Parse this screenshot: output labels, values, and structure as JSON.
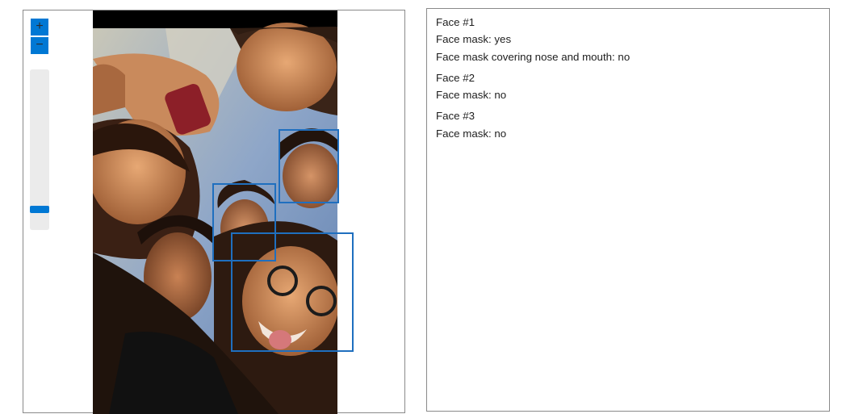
{
  "viewer": {
    "zoom_in_label": "+",
    "zoom_out_label": "−",
    "zoom_level": 0.1,
    "photo_description_icon": "group-selfie-photo"
  },
  "faces": [
    {
      "title": "Face #1",
      "lines": [
        "Face mask: yes",
        "Face mask covering nose and mouth: no"
      ]
    },
    {
      "title": "Face #2",
      "lines": [
        "Face mask: no"
      ]
    },
    {
      "title": "Face #3",
      "lines": [
        "Face mask: no"
      ]
    }
  ],
  "colors": {
    "accent": "#0078d4",
    "box": "#1f6fbf"
  }
}
